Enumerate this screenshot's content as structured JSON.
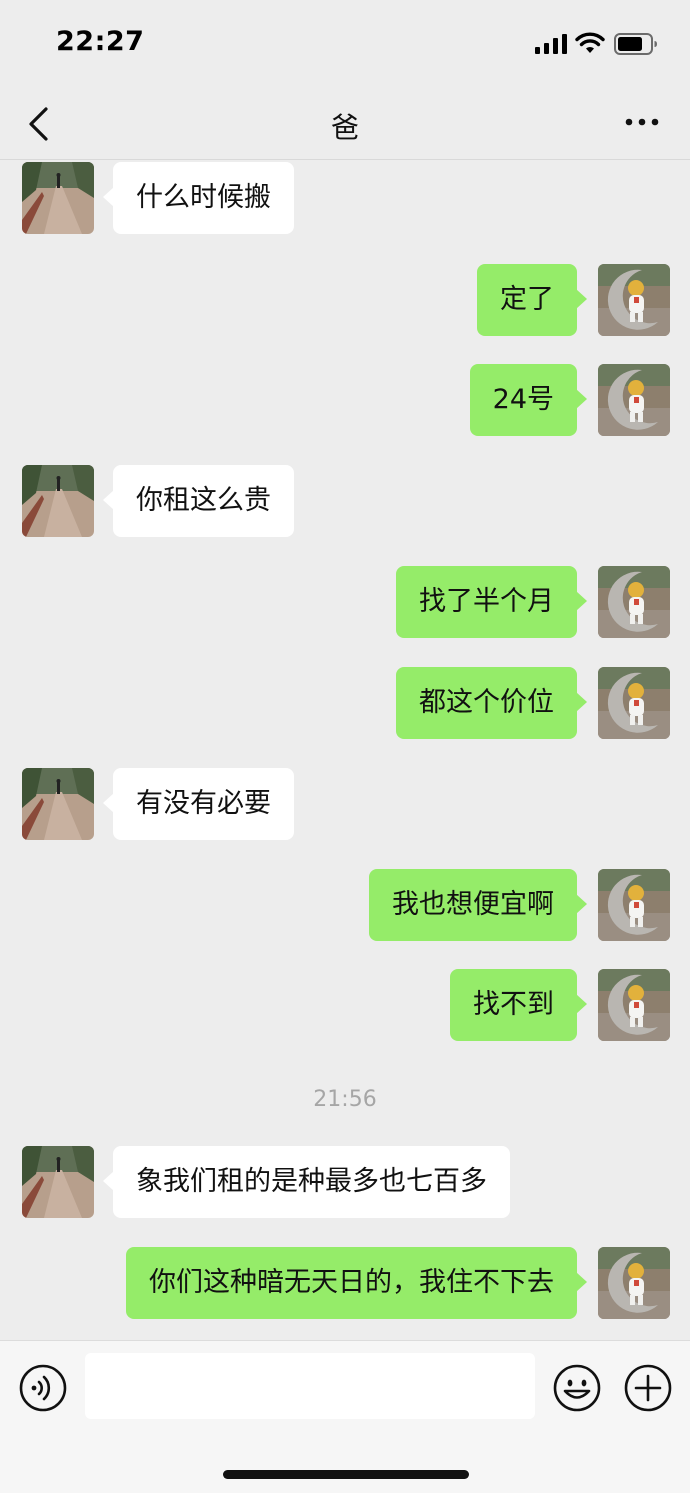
{
  "status": {
    "time": "22:27"
  },
  "nav": {
    "title": "爸"
  },
  "messages": [
    {
      "side": "in",
      "text": "什么时候搬"
    },
    {
      "side": "out",
      "text": "定了"
    },
    {
      "side": "out",
      "text": "24号"
    },
    {
      "side": "in",
      "text": "你租这么贵"
    },
    {
      "side": "out",
      "text": "找了半个月"
    },
    {
      "side": "out",
      "text": "都这个价位"
    },
    {
      "side": "in",
      "text": "有没有必要"
    },
    {
      "side": "out",
      "text": "我也想便宜啊"
    },
    {
      "side": "out",
      "text": "找不到"
    },
    {
      "side": "in",
      "text": "象我们租的是种最多也七百多"
    },
    {
      "side": "out",
      "text": "你们这种暗无天日的，我住不下去"
    }
  ],
  "timestamp": "21:56",
  "input": {
    "placeholder": ""
  },
  "icons": {
    "back": "chevron-left-icon",
    "more": "more-dots-icon",
    "voice": "voice-icon",
    "emoji": "emoji-icon",
    "plus": "plus-icon"
  },
  "colors": {
    "outgoing_bubble": "#95ec69",
    "incoming_bubble": "#ffffff",
    "background": "#ededed"
  }
}
